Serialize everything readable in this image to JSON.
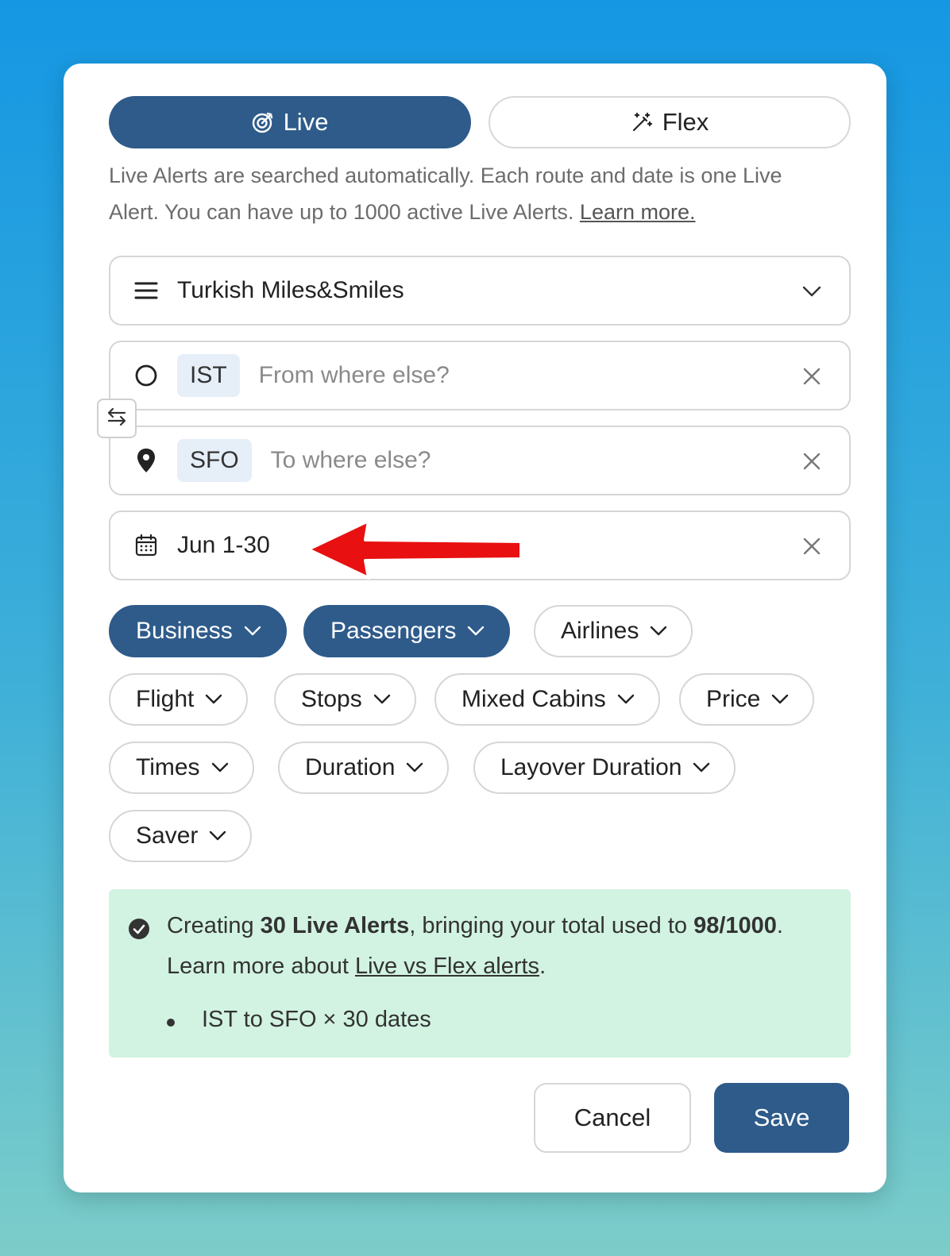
{
  "modes": {
    "live_label": "Live",
    "flex_label": "Flex",
    "active": "Live"
  },
  "description": {
    "text": "Live Alerts are searched automatically. Each route and date is one Live Alert. You can have up to 1000 active Live Alerts.",
    "link": "Learn more."
  },
  "program": {
    "value": "Turkish Miles&Smiles",
    "icon": "menu-icon"
  },
  "origin": {
    "code": "IST",
    "placeholder": "From where else?",
    "icon": "circle-icon"
  },
  "destination": {
    "code": "SFO",
    "placeholder": "To where else?",
    "icon": "map-pin-icon"
  },
  "dates": {
    "value": "Jun 1-30",
    "icon": "calendar-icon"
  },
  "filters": [
    {
      "label": "Business",
      "active": true
    },
    {
      "label": "Passengers",
      "active": true
    },
    {
      "label": "Airlines",
      "active": false
    },
    {
      "label": "Flight",
      "active": false
    },
    {
      "label": "Stops",
      "active": false
    },
    {
      "label": "Mixed Cabins",
      "active": false
    },
    {
      "label": "Price",
      "active": false
    },
    {
      "label": "Times",
      "active": false
    },
    {
      "label": "Duration",
      "active": false
    },
    {
      "label": "Layover Duration",
      "active": false
    },
    {
      "label": "Saver",
      "active": false
    }
  ],
  "summary": {
    "prefix": "Creating ",
    "count": "30 Live Alerts",
    "middle": ", bringing your total used to ",
    "total": "98/1000",
    "suffix": ".",
    "learn_prefix": "Learn more about ",
    "learn_link": "Live vs Flex alerts",
    "learn_suffix": ".",
    "bullets": [
      "IST to SFO × 30 dates"
    ]
  },
  "actions": {
    "cancel": "Cancel",
    "save": "Save"
  },
  "colors": {
    "primary": "#2e5b8a",
    "info_bg": "#d2f3e2",
    "annotation_arrow": "#e81010"
  }
}
